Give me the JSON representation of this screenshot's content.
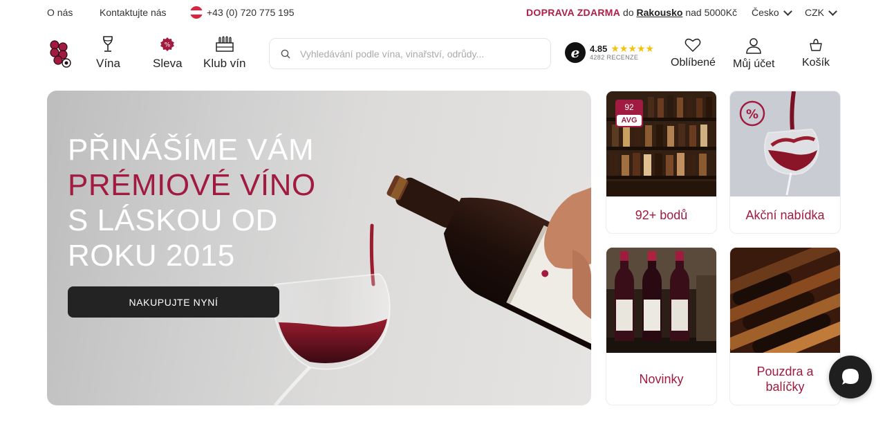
{
  "topbar": {
    "about": "O nás",
    "contact": "Kontaktujte nás",
    "phone": "+43 (0) 720 775 195",
    "shipping_free": "DOPRAVA ZDARMA",
    "shipping_to": "do",
    "shipping_country": "Rakousko",
    "shipping_threshold": "nad 5000Kč",
    "language": "Česko",
    "currency": "CZK"
  },
  "nav": {
    "wines": "Vína",
    "sale": "Sleva",
    "club": "Klub vín"
  },
  "search": {
    "placeholder": "Vyhledávání podle vína, vinařství, odrůdy..."
  },
  "rating": {
    "score": "4.85",
    "stars": "★★★★★",
    "count": "4282 RECENZE"
  },
  "header_actions": {
    "favorites": "Oblíbené",
    "account": "Můj účet",
    "cart": "Košík"
  },
  "hero": {
    "title_line1": "PŘINÁŠÍME VÁM",
    "title_accent": "PRÉMIOVÉ VÍNO",
    "title_rest": " S LÁSKOU OD ROKU 2015",
    "button": "NAKUPUJTE NYNÍ"
  },
  "tiles": [
    {
      "label": "92+ bodů",
      "badge_top": "92",
      "badge_bottom": "AVG"
    },
    {
      "label": "Akční nabídka",
      "badge_icon": "%"
    },
    {
      "label": "Novinky"
    },
    {
      "label": "Pouzdra a balíčky"
    }
  ],
  "colors": {
    "brand": "#a01b3f",
    "button_dark": "#232323",
    "stars": "#f4c20d"
  },
  "icons": [
    "austria-flag-icon",
    "grapes-logo-icon",
    "wine-glass-icon",
    "percent-badge-icon",
    "wine-crate-icon",
    "search-icon",
    "rating-e-icon",
    "heart-icon",
    "user-icon",
    "basket-icon",
    "chat-icon",
    "chevron-down-icon"
  ]
}
